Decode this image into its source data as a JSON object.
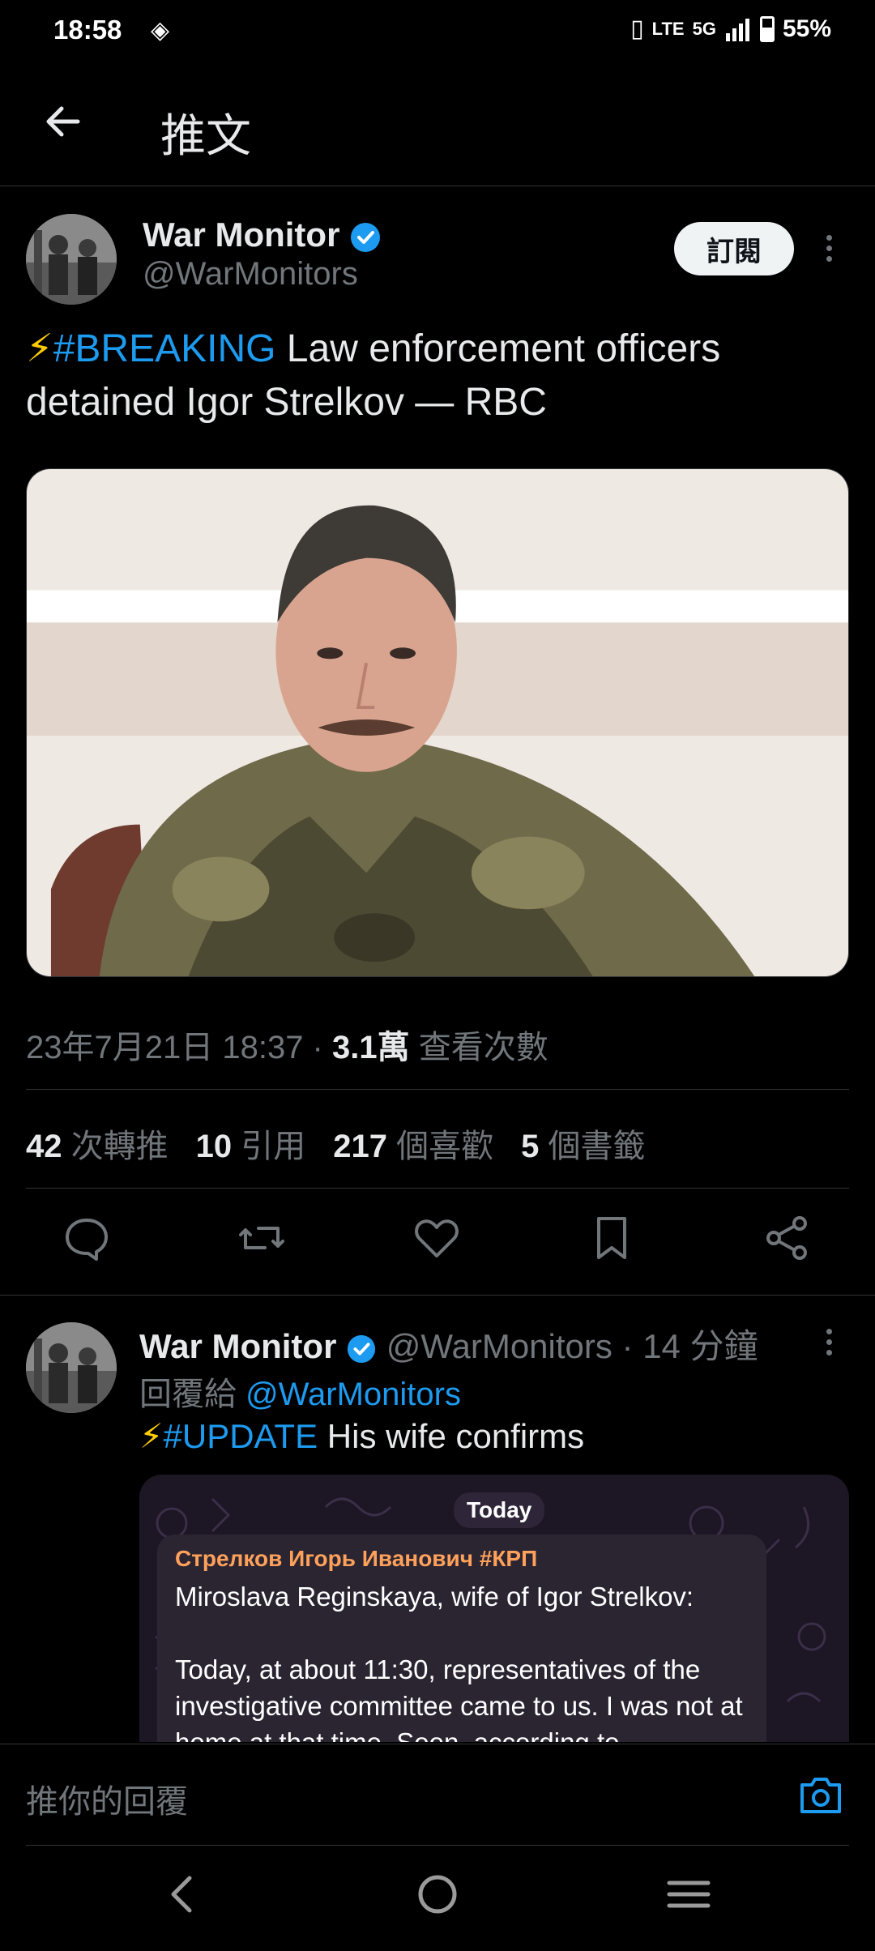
{
  "status": {
    "time": "18:58",
    "network": "5G",
    "lte": "LTE",
    "battery": "55%"
  },
  "header": {
    "title": "推文"
  },
  "tweet": {
    "name": "War Monitor",
    "handle": "@WarMonitors",
    "subscribe_label": "訂閱",
    "text_tag": "#BREAKING",
    "text_body": " Law enforcement officers detained Igor Strelkov — RBC",
    "timestamp": "23年7月21日 18:37 · ",
    "views_count": "3.1萬",
    "views_label": " 查看次數",
    "stats": {
      "retweets_count": "42",
      "retweets_label": " 次轉推",
      "quotes_count": "10",
      "quotes_label": " 引用",
      "likes_count": "217",
      "likes_label": " 個喜歡",
      "bookmarks_count": "5",
      "bookmarks_label": " 個書籤"
    }
  },
  "reply": {
    "name": "War Monitor",
    "handle_time": " @WarMonitors · 14 分鐘",
    "reply_to_prefix": "回覆給 ",
    "reply_to_handle": "@WarMonitors",
    "text_tag": "#UPDATE",
    "text_body": " His wife confirms",
    "embed": {
      "day_label": "Today",
      "author": "Стрелков Игорь Иванович #КРП",
      "body": "Miroslava Reginskaya, wife of Igor Strelkov:\n\nToday, at about 11:30, representatives of the investigative committee came to us. I was not at home at that time. Soon, according to"
    }
  },
  "composer": {
    "placeholder": "推你的回覆"
  },
  "colors": {
    "accent": "#1d9bf0",
    "background": "#000000",
    "muted": "#71767b",
    "bolt": "#ffcc00"
  }
}
